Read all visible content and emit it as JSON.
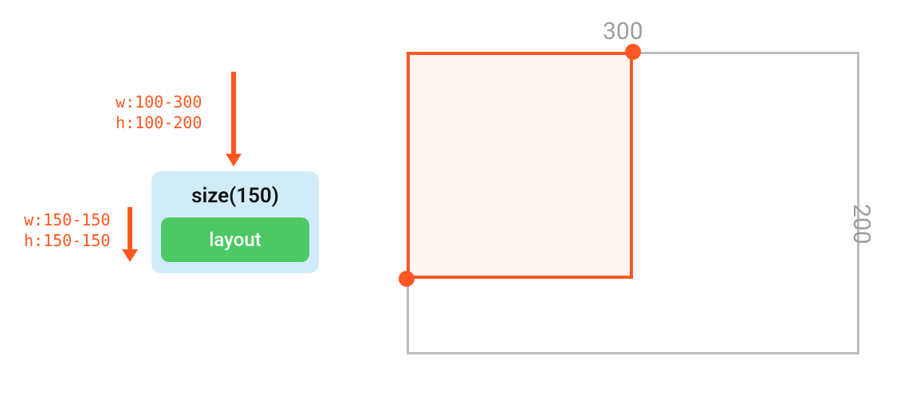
{
  "constraints": {
    "incoming": "w:100-300\nh:100-200",
    "outgoing": "w:150-150\nh:150-150"
  },
  "node": {
    "title": "size(150)",
    "child_label": "layout"
  },
  "dimensions": {
    "outer_width_label": "300",
    "outer_height_label": "200"
  }
}
